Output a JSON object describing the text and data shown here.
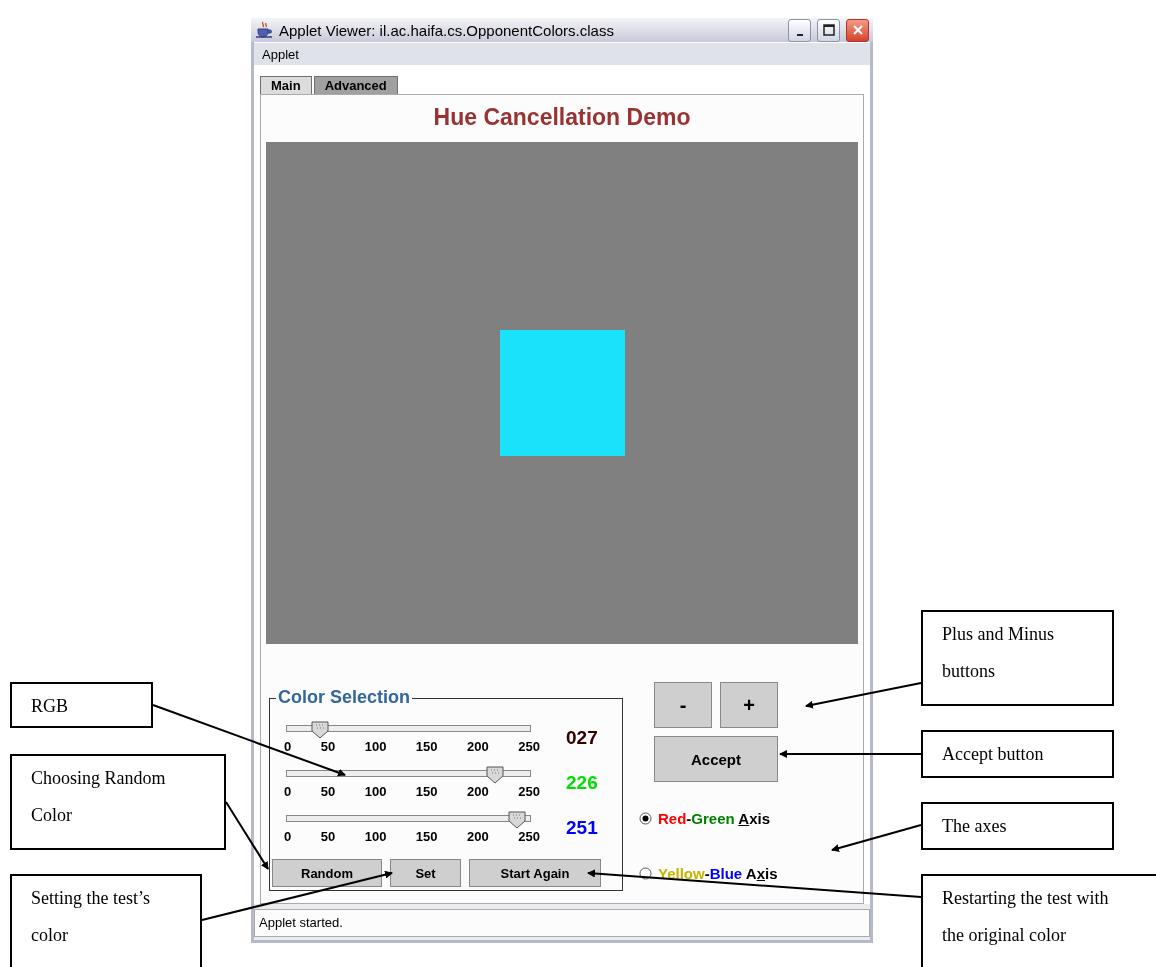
{
  "window": {
    "title": "Applet Viewer: il.ac.haifa.cs.OpponentColors.class"
  },
  "menu": [
    "Applet"
  ],
  "tabs": [
    {
      "label": "Main",
      "selected": true
    },
    {
      "label": "Advanced",
      "selected": false
    }
  ],
  "heading": "Hue Cancellation Demo",
  "preview": {
    "color": "#1be2fb"
  },
  "color_selection": {
    "title": "Color Selection",
    "sliders": [
      {
        "level": 0.106,
        "ticks": [
          "0",
          "50",
          "100",
          "150",
          "200",
          "250"
        ],
        "reading": "027",
        "color": "#330000"
      },
      {
        "level": 0.886,
        "ticks": [
          "0",
          "50",
          "100",
          "150",
          "200",
          "250"
        ],
        "reading": "226",
        "color": "#00e000"
      },
      {
        "level": 0.984,
        "ticks": [
          "0",
          "50",
          "100",
          "150",
          "200",
          "250"
        ],
        "reading": "251",
        "color": "#0000ff"
      }
    ],
    "buttons": [
      "Random",
      "Set",
      "Start Again"
    ]
  },
  "step_buttons": [
    "-",
    "+"
  ],
  "accept_button": "Accept",
  "axes": [
    {
      "selected": true,
      "parts": [
        {
          "text": "Red",
          "color": "#ff0000"
        },
        {
          "text": "-",
          "color": "#000000"
        },
        {
          "text": "Green ",
          "color": "#008000"
        },
        {
          "text": "A",
          "color": "#000000",
          "underline": true
        },
        {
          "text": "xis",
          "color": "#000000"
        }
      ]
    },
    {
      "selected": false,
      "parts": [
        {
          "text": "Yellow",
          "color": "#c8b400"
        },
        {
          "text": "-",
          "color": "#000000"
        },
        {
          "text": "Blue",
          "color": "#0000ff"
        },
        {
          "text": " A",
          "color": "#000000"
        },
        {
          "text": "x",
          "color": "#000000",
          "underline": true
        },
        {
          "text": "is",
          "color": "#000000"
        }
      ]
    }
  ],
  "status_bar": "Applet started.",
  "callouts": [
    {
      "text": "RGB"
    },
    {
      "text": "Choosing Random Color"
    },
    {
      "text": "Setting the test’s color"
    },
    {
      "text": "Plus and Minus buttons"
    },
    {
      "text": "Accept button"
    },
    {
      "text": "The axes"
    },
    {
      "text": "Restarting the test with the original color"
    }
  ]
}
